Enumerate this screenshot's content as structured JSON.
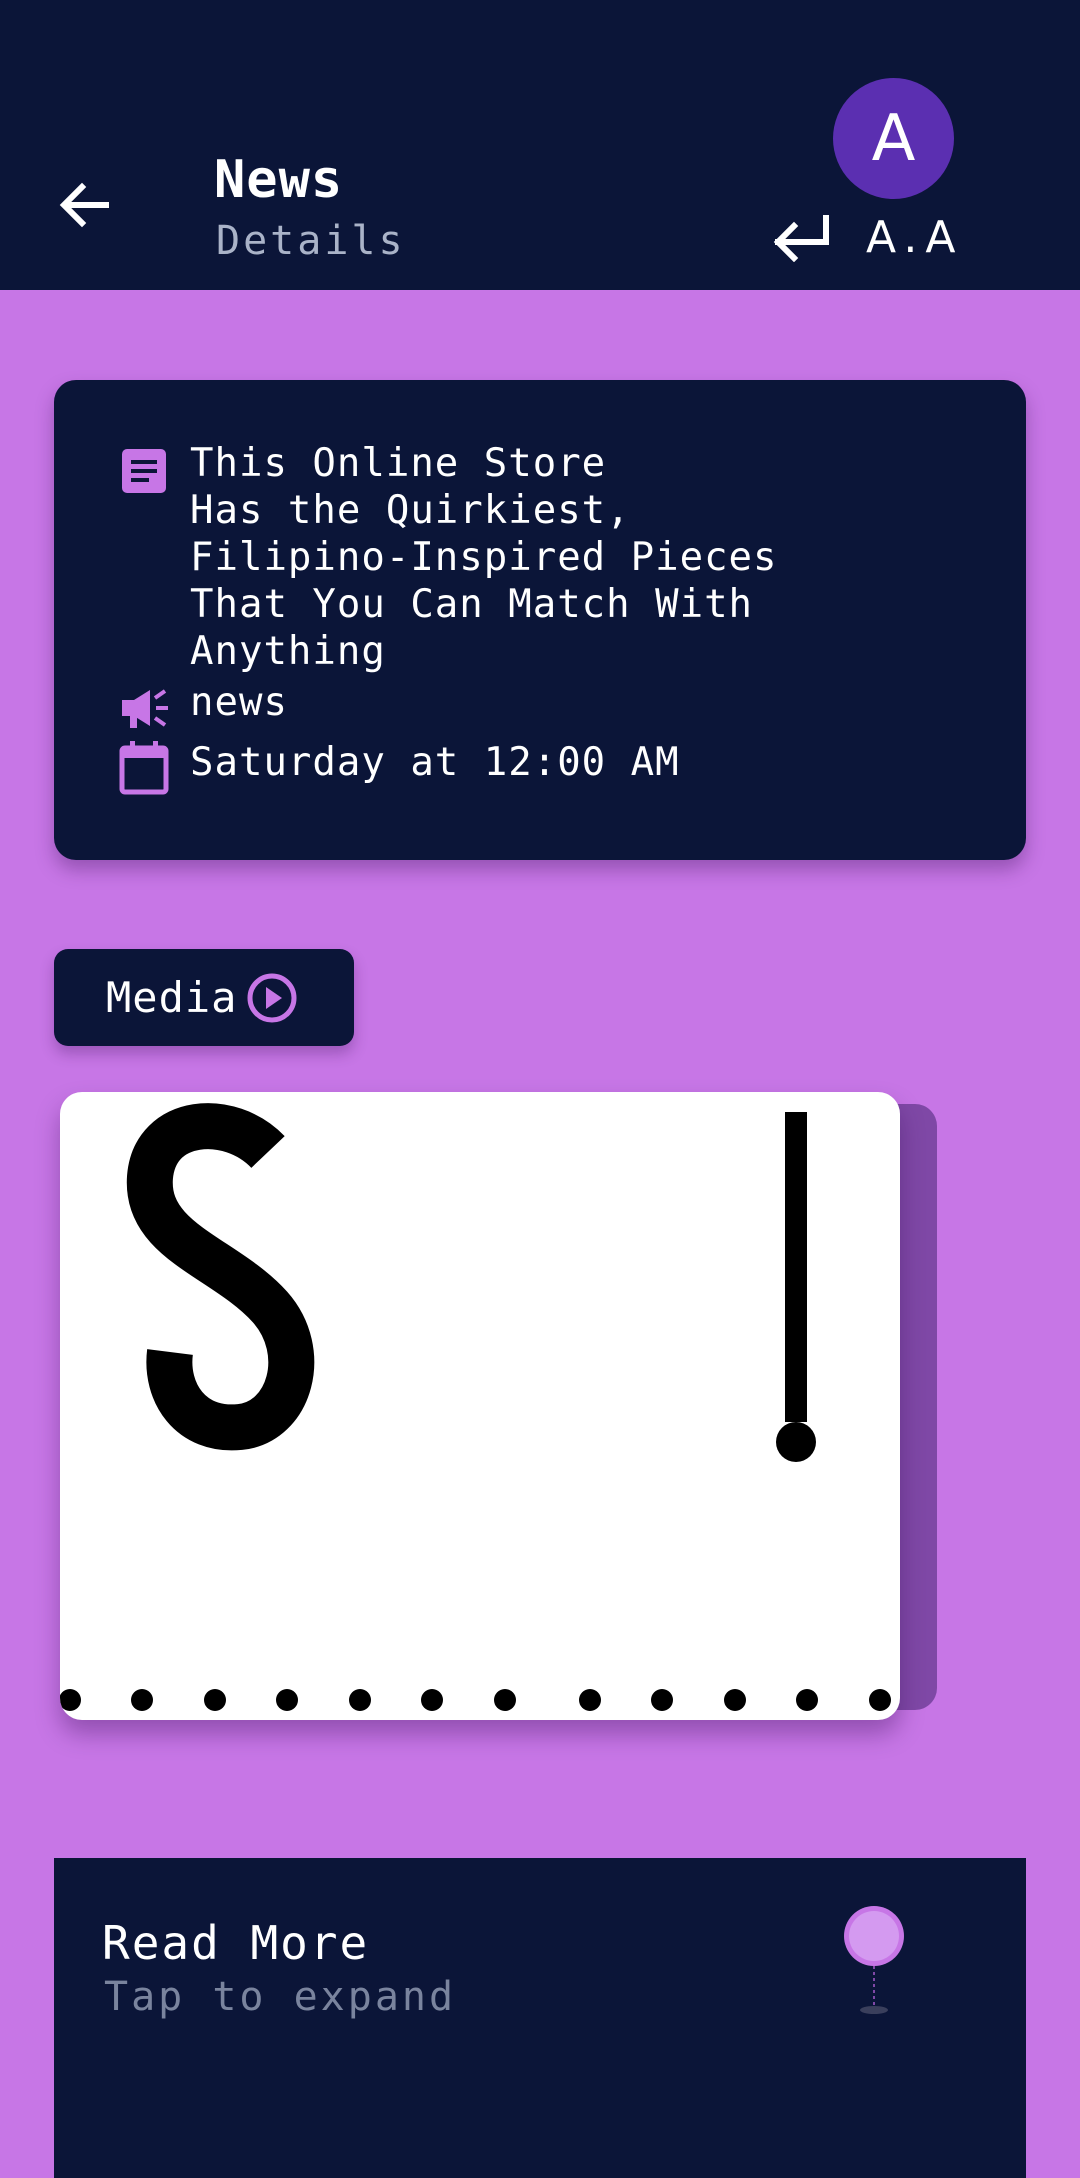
{
  "header": {
    "title": "News",
    "subtitle": "Details",
    "avatar_letter": "A",
    "user_name": "A.A"
  },
  "article": {
    "headline": "This Online Store\nHas the Quirkiest,\nFilipino-Inspired Pieces\nThat You Can Match With\nAnything",
    "category": "news",
    "date": "Saturday at 12:00 AM"
  },
  "media": {
    "button_label": "Media"
  },
  "read_more": {
    "title": "Read More",
    "subtitle": "Tap to expand"
  },
  "colors": {
    "background": "#c776e6",
    "dark": "#0b1538",
    "accent": "#c776e6",
    "avatar": "#5b2fb1"
  },
  "icons": [
    "back-arrow-icon",
    "logout-icon",
    "article-icon",
    "megaphone-icon",
    "calendar-icon",
    "play-circle-icon",
    "pin-icon"
  ]
}
